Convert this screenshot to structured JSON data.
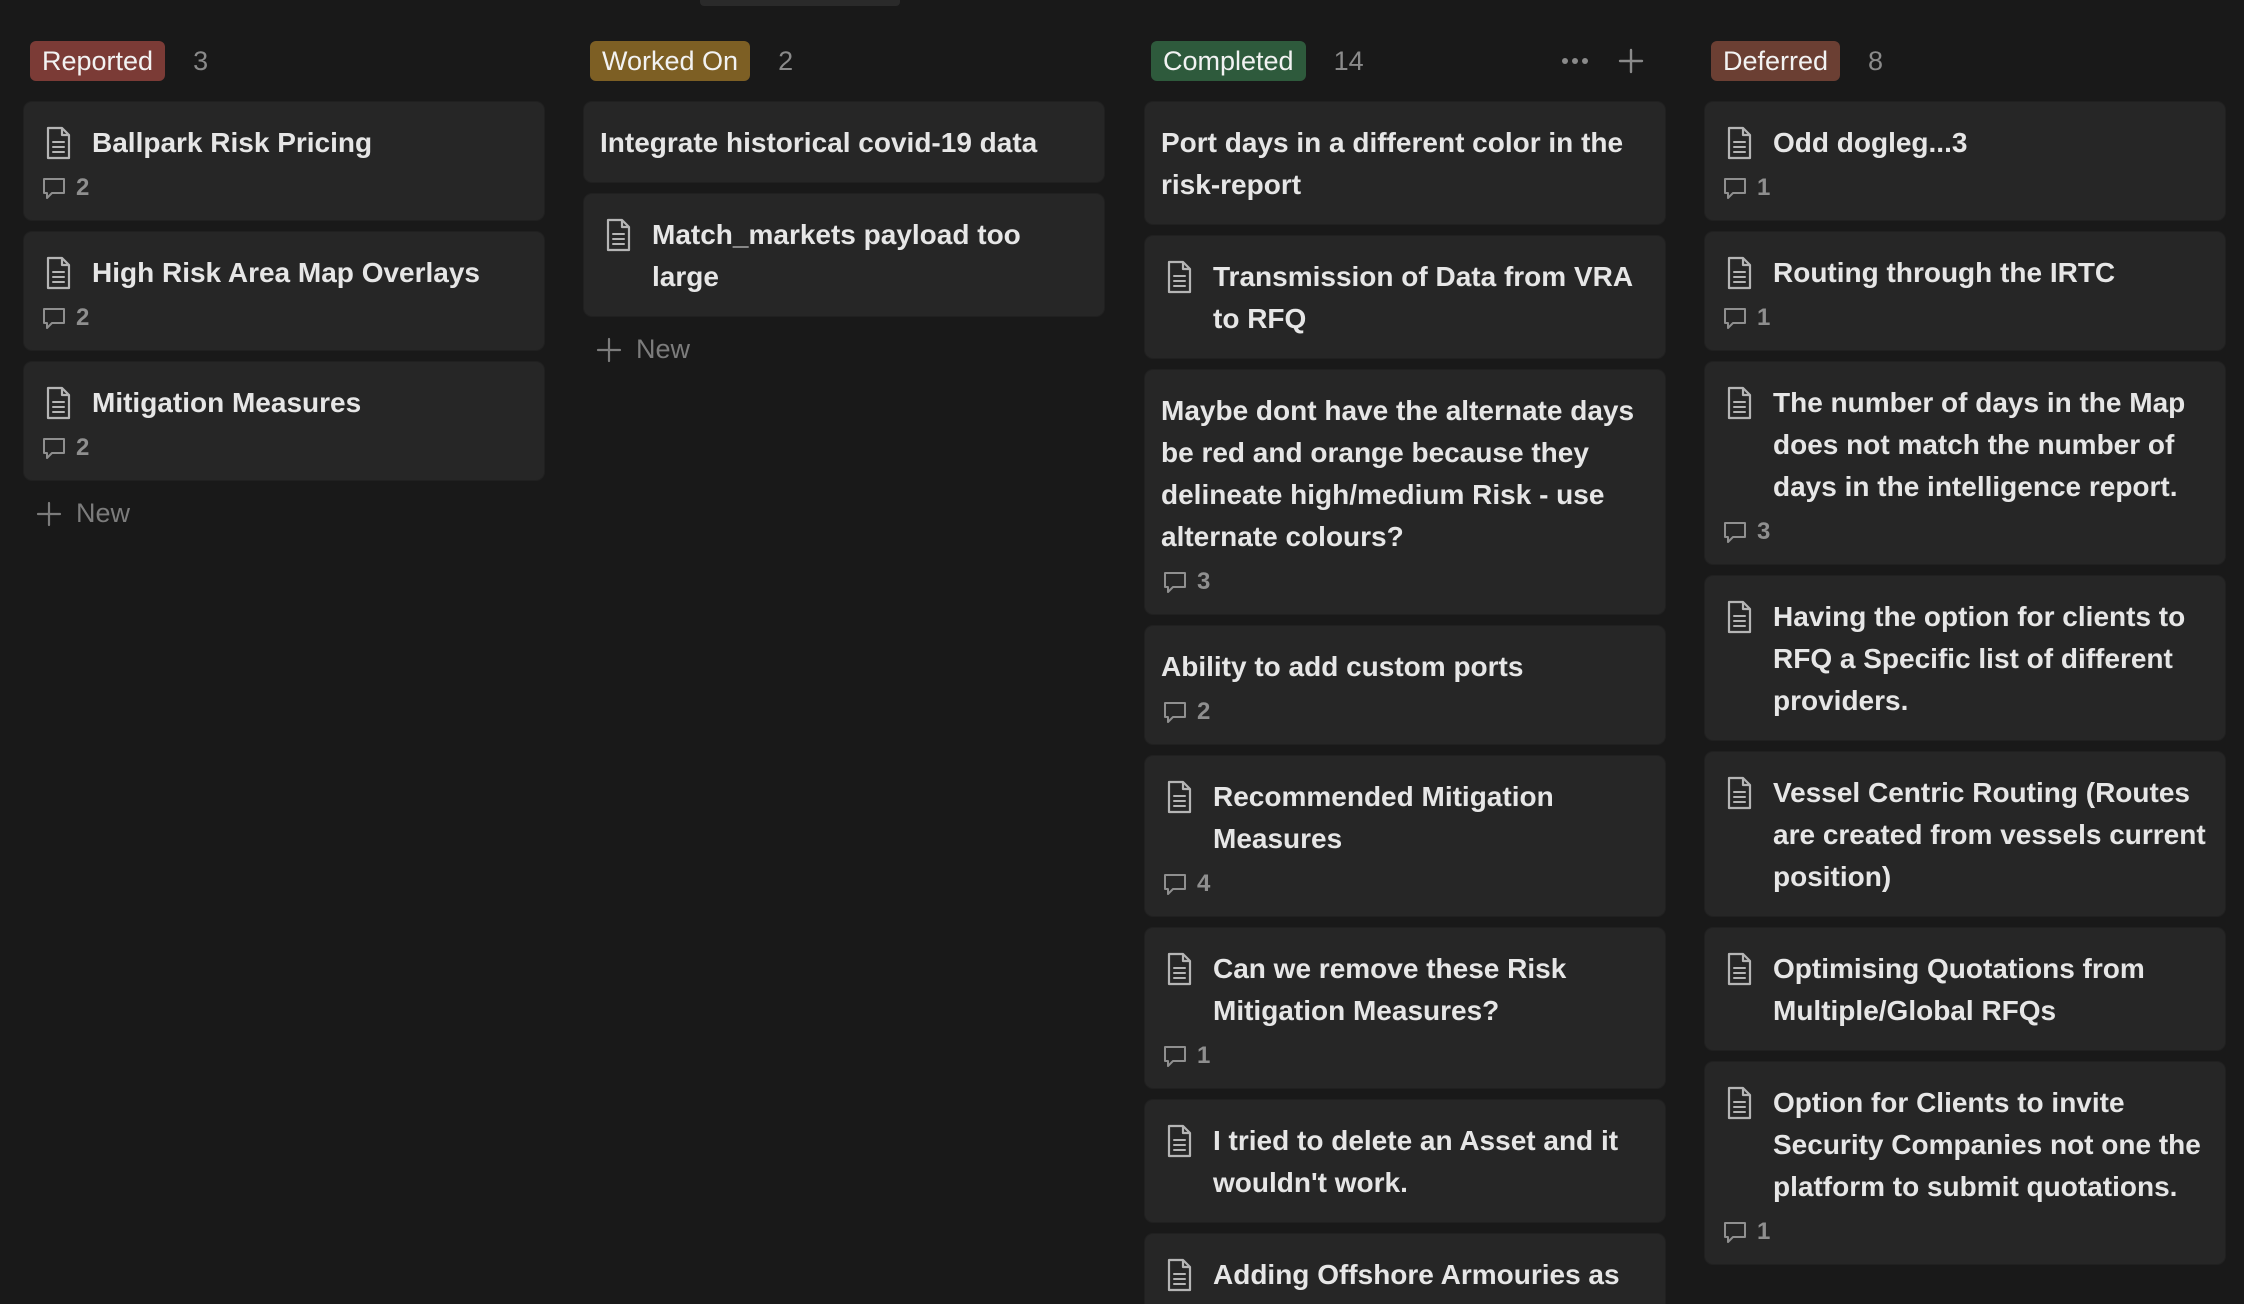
{
  "columns": [
    {
      "id": "reported",
      "tag_label": "Reported",
      "tag_color": "#7b3b36",
      "count": "3",
      "cards": [
        {
          "title": "Ballpark Risk Pricing",
          "icon": "page-icon",
          "comments": "2"
        },
        {
          "title": "High Risk Area Map Overlays",
          "icon": "page-icon",
          "comments": "2"
        },
        {
          "title": "Mitigation Measures",
          "icon": "page-icon",
          "comments": "2"
        }
      ],
      "new_label": "New"
    },
    {
      "id": "worked-on",
      "tag_label": "Worked On",
      "tag_color": "#7d5f24",
      "count": "2",
      "cards": [
        {
          "title": "Integrate historical covid-19 data",
          "icon": "",
          "comments": ""
        },
        {
          "title": "Match_markets payload too large",
          "icon": "page-icon",
          "comments": ""
        }
      ],
      "new_label": "New"
    },
    {
      "id": "completed",
      "tag_label": "Completed",
      "tag_color": "#2e5a3c",
      "count": "14",
      "cards": [
        {
          "title": "Port days in a different color in the risk-report",
          "icon": "",
          "comments": ""
        },
        {
          "title": "Transmission of Data from VRA to RFQ",
          "icon": "page-icon",
          "comments": ""
        },
        {
          "title": "Maybe dont have the alternate days be red and orange because they delineate high/medium Risk - use alternate colours?",
          "icon": "",
          "comments": "3"
        },
        {
          "title": "Ability to add custom ports",
          "icon": "",
          "comments": "2"
        },
        {
          "title": "Recommended Mitigation Measures",
          "icon": "page-icon",
          "comments": "4"
        },
        {
          "title": "Can we remove these Risk Mitigation Measures?",
          "icon": "page-icon",
          "comments": "1"
        },
        {
          "title": "I tried to delete an Asset and it wouldn't work.",
          "icon": "page-icon",
          "comments": ""
        },
        {
          "title": "Adding Offshore Armouries as",
          "icon": "page-icon",
          "comments": ""
        }
      ],
      "new_label": ""
    },
    {
      "id": "deferred",
      "tag_label": "Deferred",
      "tag_color": "#6b3f33",
      "count": "8",
      "cards": [
        {
          "title": "Odd dogleg...3",
          "icon": "page-icon",
          "comments": "1"
        },
        {
          "title": "Routing through the IRTC",
          "icon": "page-icon",
          "comments": "1"
        },
        {
          "title": "The number of days in the Map does not match the number of days in the intelligence report.",
          "icon": "page-icon",
          "comments": "3"
        },
        {
          "title": "Having the option for clients to RFQ a Specific list of different providers.",
          "icon": "page-icon",
          "comments": ""
        },
        {
          "title": "Vessel Centric Routing (Routes are created from vessels current position)",
          "icon": "page-icon",
          "comments": ""
        },
        {
          "title": "Optimising Quotations from Multiple/Global RFQs",
          "icon": "page-icon",
          "comments": ""
        },
        {
          "title": "Option for Clients to invite Security Companies not one the platform to submit quotations.",
          "icon": "page-icon",
          "comments": "1"
        }
      ],
      "new_label": ""
    }
  ],
  "icons": {
    "more": "more-horizontal-icon",
    "add": "plus-icon",
    "comment": "comment-icon",
    "page": "page-icon"
  }
}
